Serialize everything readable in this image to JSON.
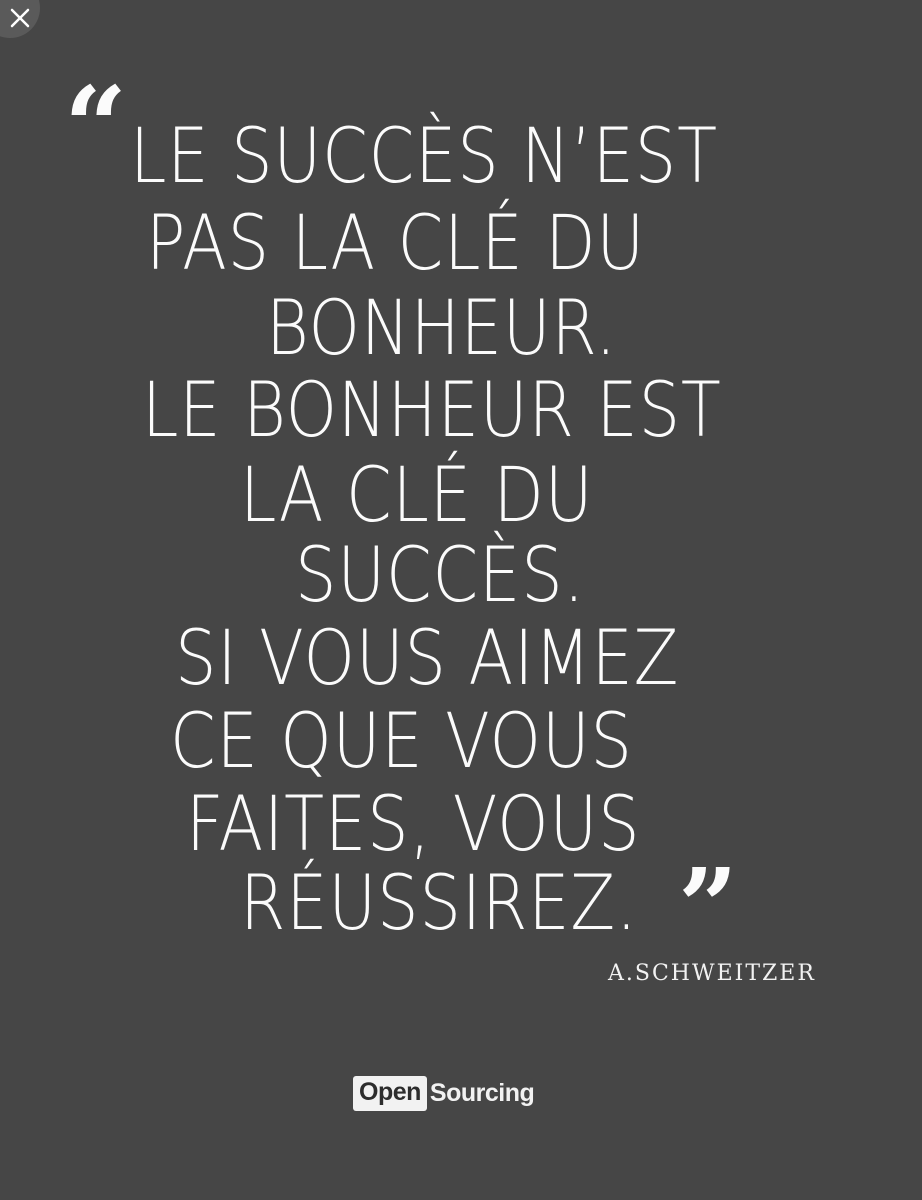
{
  "quote": {
    "lines": [
      "LE SUCCÈS N’EST",
      "PAS LA CLÉ DU",
      "BONHEUR.",
      "LE BONHEUR EST",
      "LA CLÉ DU",
      "SUCCÈS.",
      "SI VOUS AIMEZ",
      "CE QUE VOUS",
      "FAITES, VOUS",
      "RÉUSSIREZ."
    ],
    "open_mark": "“",
    "close_mark": "”"
  },
  "author": "A.SCHWEITZER",
  "logo": {
    "part1": "Open",
    "part2": "Sourcing"
  },
  "colors": {
    "background": "#464646",
    "text": "#fbfbfb"
  },
  "icons": {
    "close": "close-icon"
  }
}
